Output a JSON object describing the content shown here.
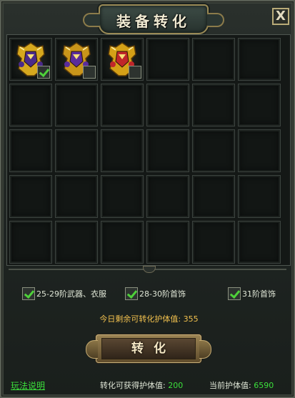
{
  "window": {
    "title": "装备转化",
    "close_label": "X"
  },
  "items": [
    {
      "name": "golden-armor",
      "checked": true,
      "colors": {
        "main": "#d6a81e",
        "accent": "#4a2a8a"
      }
    },
    {
      "name": "golden-armor-purple",
      "checked": false,
      "colors": {
        "main": "#c9951a",
        "accent": "#5a2c9c"
      }
    },
    {
      "name": "red-gold-armor",
      "checked": false,
      "colors": {
        "main": "#d4a017",
        "accent": "#c0262a"
      }
    }
  ],
  "grid": {
    "columns": 6,
    "rows": 5
  },
  "options": [
    {
      "label": "25-29阶武器、衣服",
      "checked": true
    },
    {
      "label": "28-30阶首饰",
      "checked": true
    },
    {
      "label": "31阶首饰",
      "checked": true
    }
  ],
  "remaining": {
    "text": "今日剩余可转化护体值: 355"
  },
  "convert_button": {
    "label": "转化"
  },
  "footer": {
    "help_label": "玩法说明",
    "obtainable_label": "转化可获得护体值: ",
    "obtainable_value": "200",
    "current_label": "当前护体值: ",
    "current_value": "6590"
  },
  "colors": {
    "check_green": "#4ed13a",
    "value_green": "#3be03b",
    "gold_text": "#f2c14e"
  }
}
